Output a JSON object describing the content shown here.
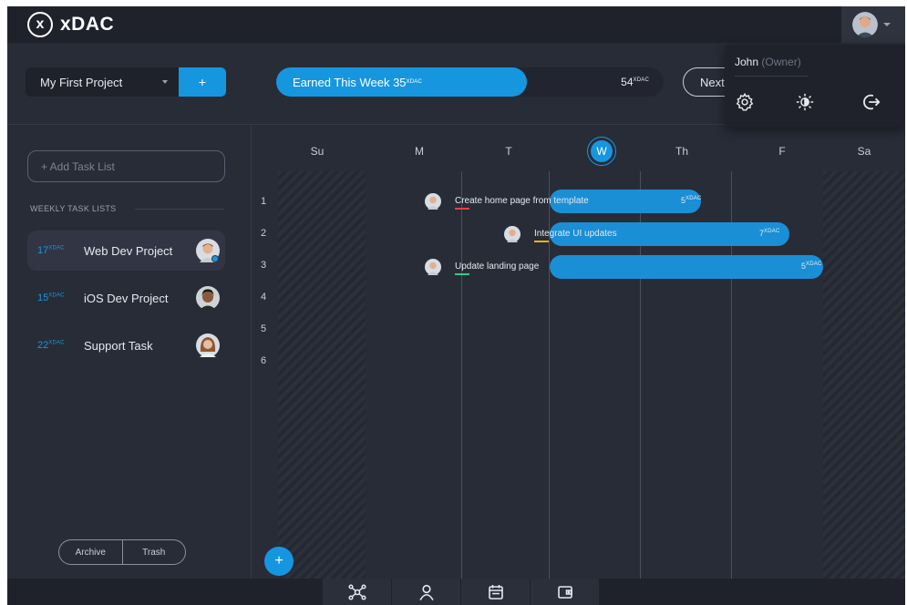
{
  "app": {
    "logo_mark": "x",
    "logo_text": "xDAC"
  },
  "user_menu": {
    "name": "John",
    "role": "(Owner)"
  },
  "header": {
    "project_name": "My First Project",
    "add_label": "+",
    "earned_label": "Earned This Week 35",
    "earned_unit": "XDAC",
    "earned_value": 35,
    "earned_total_label": "54",
    "earned_total_unit": "XDAC",
    "earned_total": 54,
    "next_label": "Next"
  },
  "sidebar": {
    "add_list_placeholder": "+ Add Task List",
    "section_title": "WEEKLY TASK LISTS",
    "task_lists": [
      {
        "points": "17",
        "unit": "XDAC",
        "name": "Web Dev Project",
        "active": true
      },
      {
        "points": "15",
        "unit": "XDAC",
        "name": "iOS Dev Project",
        "active": false
      },
      {
        "points": "22",
        "unit": "XDAC",
        "name": "Support Task",
        "active": false
      }
    ],
    "archive_label": "Archive",
    "trash_label": "Trash"
  },
  "calendar": {
    "days": [
      "Su",
      "M",
      "T",
      "W",
      "Th",
      "F",
      "Sa"
    ],
    "today": "W",
    "rows": [
      "1",
      "2",
      "3",
      "4",
      "5",
      "6"
    ],
    "tasks": [
      {
        "title": "Create home page from template",
        "points": "5",
        "unit": "XDAC",
        "color": "#e8414b"
      },
      {
        "title": "Integrate UI updates",
        "points": "7",
        "unit": "XDAC",
        "color": "#f2b21b"
      },
      {
        "title": "Update landing page",
        "points": "5",
        "unit": "XDAC",
        "color": "#2ccf7a"
      }
    ],
    "add_label": "+"
  },
  "colors": {
    "accent": "#1796e0",
    "background": "#282c37",
    "topbar": "#1f222b"
  }
}
